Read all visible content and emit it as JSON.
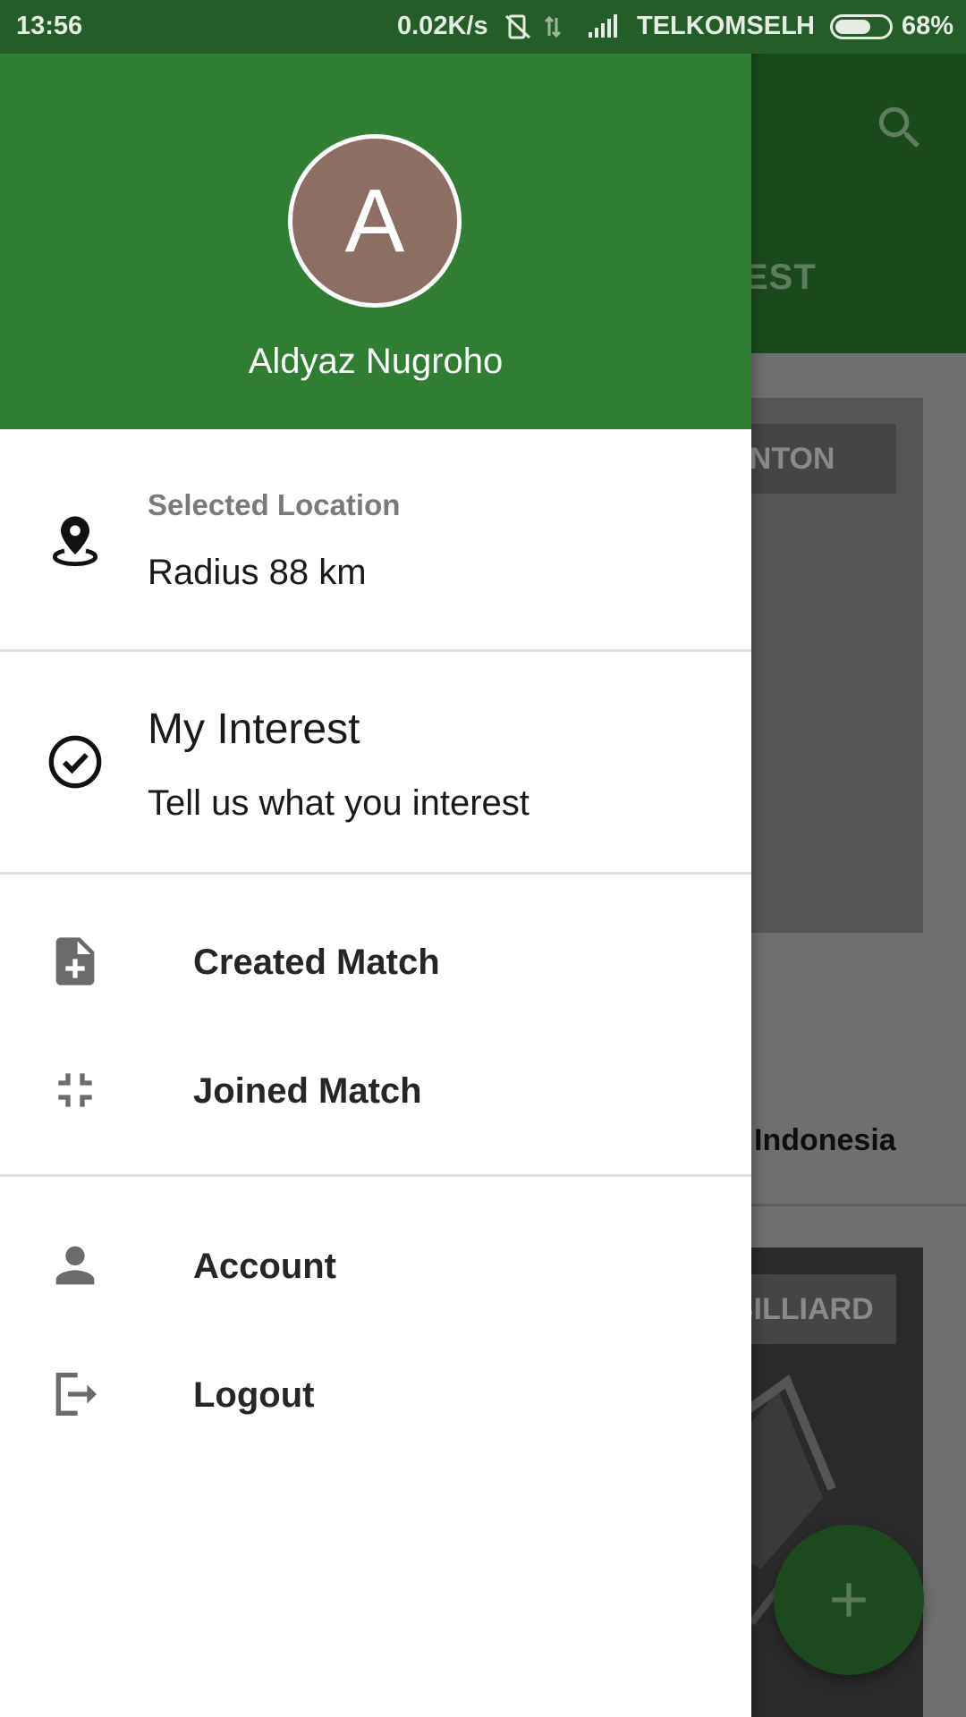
{
  "status_bar": {
    "time": "13:56",
    "speed": "0.02K/s",
    "carrier": "TELKOMSEL",
    "network": "H",
    "battery_percent": "68%",
    "battery_level": 0.68
  },
  "background": {
    "tab_partial": "EST",
    "card1_category": "MINTON",
    "card1_location": "Indonesia",
    "card2_category": "BILLIARD"
  },
  "drawer": {
    "avatar_letter": "A",
    "user_name": "Aldyaz Nugroho",
    "location": {
      "label": "Selected Location",
      "value": "Radius 88 km"
    },
    "interest": {
      "title": "My Interest",
      "subtitle": "Tell us what you interest"
    },
    "menu": {
      "created_match": "Created Match",
      "joined_match": "Joined Match",
      "account": "Account",
      "logout": "Logout"
    }
  },
  "colors": {
    "primary": "#307e34",
    "status_bar": "#255d28",
    "avatar": "#8d6e63"
  }
}
